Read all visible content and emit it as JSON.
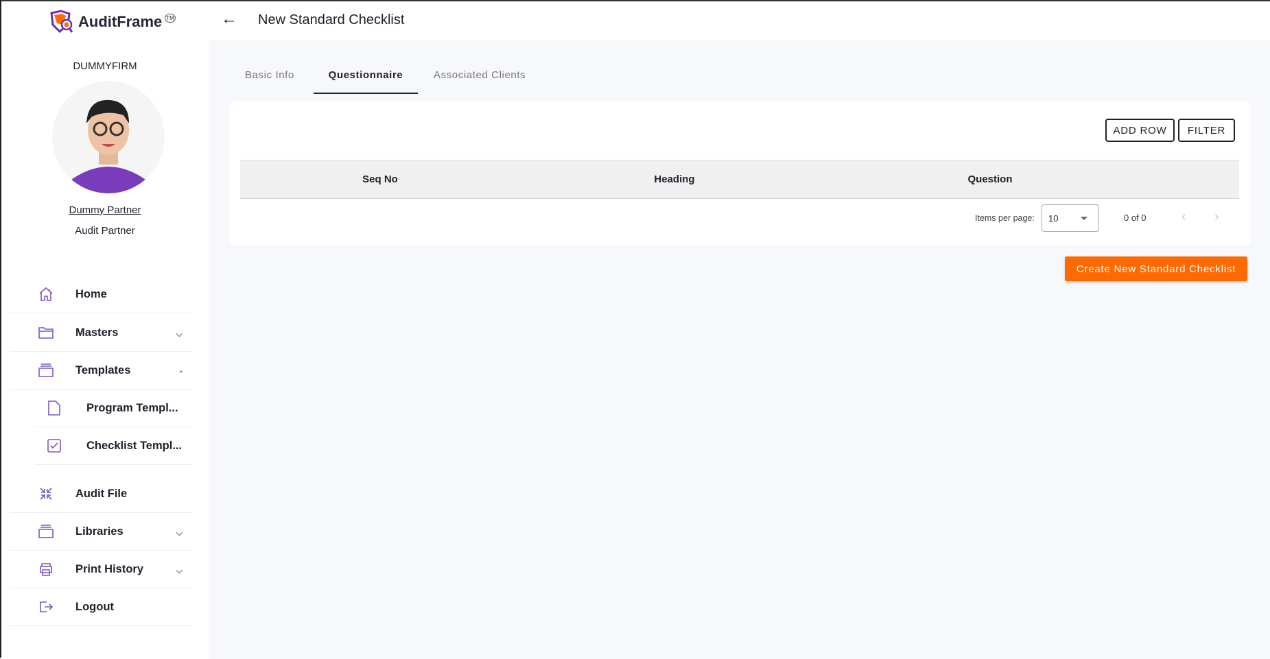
{
  "app": {
    "name": "AuditFrame",
    "tm": "TM"
  },
  "user": {
    "firm": "DUMMYFIRM",
    "name": "Dummy Partner",
    "role": "Audit Partner"
  },
  "sidebar": {
    "items": [
      {
        "label": "Home",
        "icon": "home-icon"
      },
      {
        "label": "Masters",
        "icon": "folder-icon",
        "chevron": "down"
      },
      {
        "label": "Templates",
        "icon": "stack-icon",
        "chevron": "up"
      },
      {
        "label": "Program Templ...",
        "icon": "file-icon"
      },
      {
        "label": "Checklist Templ...",
        "icon": "checkbox-icon"
      },
      {
        "label": "Audit File",
        "icon": "collapse-icon"
      },
      {
        "label": "Libraries",
        "icon": "stack-icon",
        "chevron": "down"
      },
      {
        "label": "Print History",
        "icon": "printer-icon",
        "chevron": "down"
      },
      {
        "label": "Logout",
        "icon": "logout-icon"
      }
    ]
  },
  "header": {
    "title": "New Standard Checklist"
  },
  "tabs": [
    {
      "label": "Basic Info"
    },
    {
      "label": "Questionnaire",
      "active": true
    },
    {
      "label": "Associated Clients"
    }
  ],
  "toolbar": {
    "add_row": "ADD ROW",
    "filter": "FILTER"
  },
  "table": {
    "columns": [
      "Seq No",
      "Heading",
      "Question"
    ],
    "rows": []
  },
  "pagination": {
    "items_per_page_label": "Items per page:",
    "page_size": "10",
    "range": "0 of 0"
  },
  "actions": {
    "create": "Create New Standard Checklist"
  },
  "colors": {
    "accent": "#7e57c2",
    "primary": "#ff6a00"
  }
}
